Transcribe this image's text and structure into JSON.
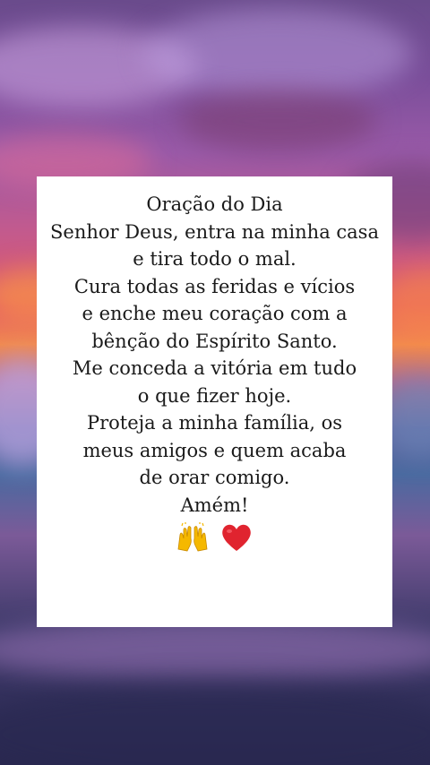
{
  "background": {
    "description_colors": [
      "#6a4b8c",
      "#c25a8e",
      "#e0566a",
      "#f28a4e",
      "#4a6aa0",
      "#2a2850"
    ]
  },
  "card": {
    "lines": [
      "Oração do Dia",
      "Senhor Deus, entra na minha casa",
      "e tira todo o mal.",
      "Cura todas as feridas e vícios",
      "e enche meu coração com a",
      "bênção do Espírito Santo.",
      "Me conceda a vitória em tudo",
      "o que fizer hoje.",
      "Proteja a minha família, os",
      "meus amigos e quem acaba",
      "de orar comigo.",
      "Amém!"
    ],
    "emoji_icons": [
      "raising-hands-icon",
      "red-heart-icon"
    ],
    "heart_color": "#e0242f",
    "hands_color": "#f5b800"
  }
}
